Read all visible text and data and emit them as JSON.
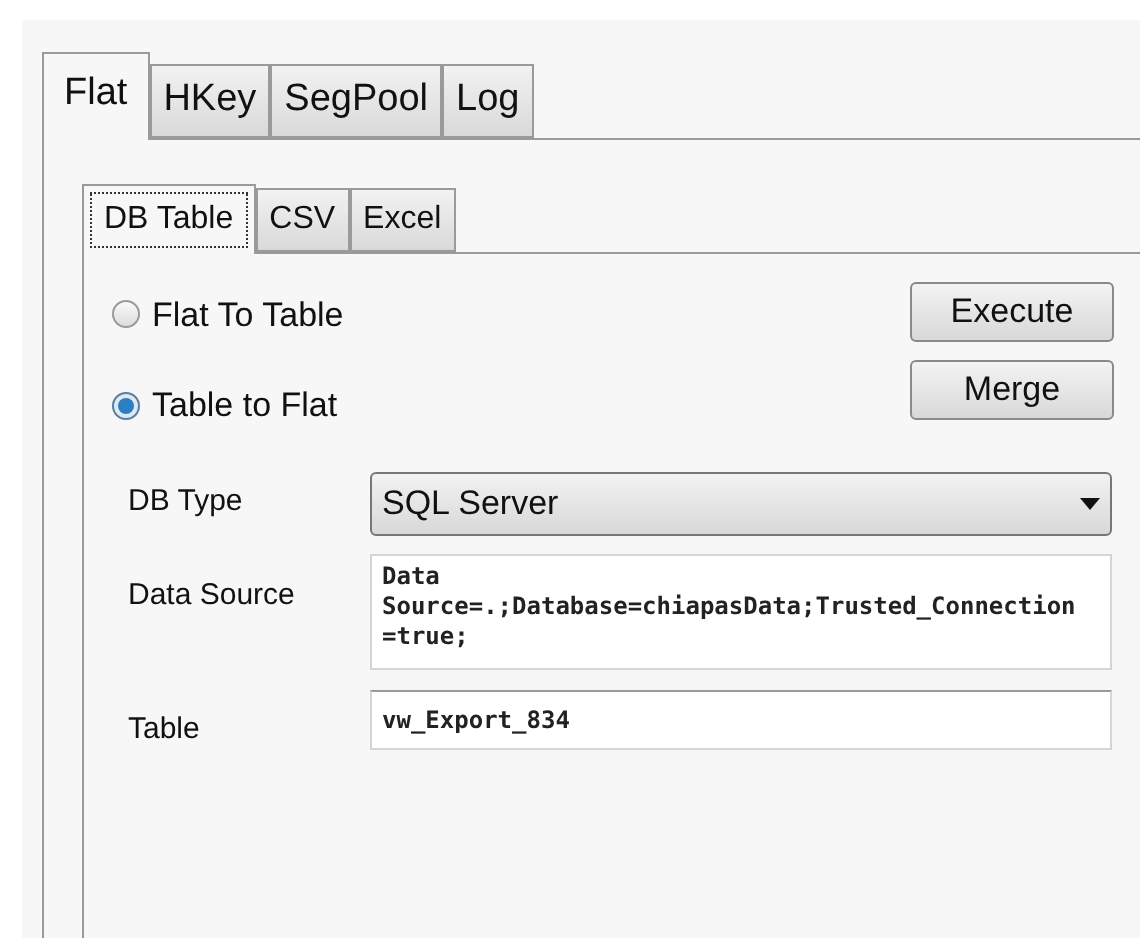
{
  "tabs": [
    {
      "label": "Flat",
      "selected": true
    },
    {
      "label": "HKey",
      "selected": false
    },
    {
      "label": "SegPool",
      "selected": false
    },
    {
      "label": "Log",
      "selected": false
    }
  ],
  "subtabs": [
    {
      "label": "DB Table",
      "selected": true
    },
    {
      "label": "CSV",
      "selected": false
    },
    {
      "label": "Excel",
      "selected": false
    }
  ],
  "modes": [
    {
      "label": "Flat To Table",
      "selected": false
    },
    {
      "label": "Table to Flat",
      "selected": true
    }
  ],
  "buttons": [
    "Execute",
    "Merge"
  ],
  "db_type": {
    "label": "DB Type",
    "value": "SQL Server"
  },
  "data_source": {
    "label": "Data Source",
    "value": "Data Source=.;Database=chiapasData;Trusted_Connection=true;"
  },
  "table": {
    "label": "Table",
    "value": "vw_Export_834"
  }
}
